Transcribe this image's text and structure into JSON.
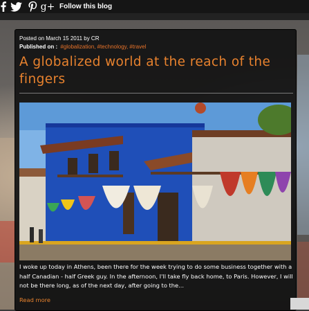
{
  "social": {
    "follow_label": "Follow this blog",
    "icons": [
      "facebook-icon",
      "twitter-icon",
      "pinterest-icon",
      "google-plus-icon"
    ],
    "google_plus_glyph": "g+"
  },
  "post": {
    "posted_line": "Posted on March 15 2011 by CR",
    "published_label": "Published on :",
    "tags": [
      "#globalization,",
      "#technology,",
      "#travel"
    ],
    "title": "A globalized world at the reach of the fingers",
    "image_alt": "Blue colonial building with hammocks hanging on the balconies",
    "excerpt": "I woke up today in Athens, been there for the week trying to do some business together with a half Canadian - half Greek guy. In the afternoon, I'll take fly back home, to Paris. However, I will not be there long, as of the next day, after going to the...",
    "read_more": "Read more"
  },
  "colors": {
    "accent": "#e8822e",
    "tag": "#e8732a",
    "card_bg": "#121212",
    "topbar_bg": "#151515"
  }
}
